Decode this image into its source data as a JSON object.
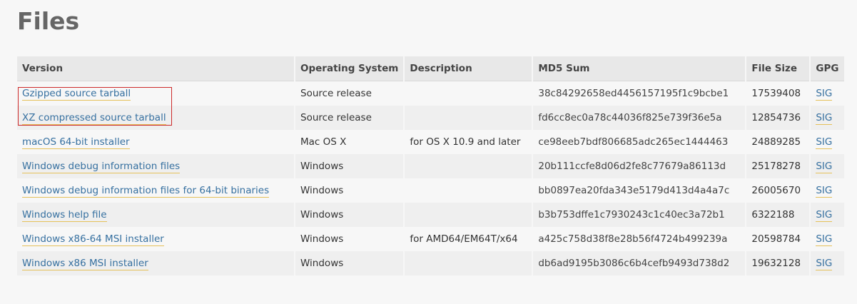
{
  "page": {
    "title": "Files"
  },
  "table": {
    "headers": {
      "version": "Version",
      "os": "Operating System",
      "description": "Description",
      "md5": "MD5 Sum",
      "size": "File Size",
      "gpg": "GPG"
    },
    "rows": [
      {
        "version": "Gzipped source tarball",
        "os": "Source release",
        "description": "",
        "md5": "38c84292658ed4456157195f1c9bcbe1",
        "size": "17539408",
        "gpg": "SIG"
      },
      {
        "version": "XZ compressed source tarball",
        "os": "Source release",
        "description": "",
        "md5": "fd6cc8ec0a78c44036f825e739f36e5a",
        "size": "12854736",
        "gpg": "SIG"
      },
      {
        "version": "macOS 64-bit installer",
        "os": "Mac OS X",
        "description": "for OS X 10.9 and later",
        "md5": "ce98eeb7bdf806685adc265ec1444463",
        "size": "24889285",
        "gpg": "SIG"
      },
      {
        "version": "Windows debug information files",
        "os": "Windows",
        "description": "",
        "md5": "20b111ccfe8d06d2fe8c77679a86113d",
        "size": "25178278",
        "gpg": "SIG"
      },
      {
        "version": "Windows debug information files for 64-bit binaries",
        "os": "Windows",
        "description": "",
        "md5": "bb0897ea20fda343e5179d413d4a4a7c",
        "size": "26005670",
        "gpg": "SIG"
      },
      {
        "version": "Windows help file",
        "os": "Windows",
        "description": "",
        "md5": "b3b753dffe1c7930243c1c40ec3a72b1",
        "size": "6322188",
        "gpg": "SIG"
      },
      {
        "version": "Windows x86-64 MSI installer",
        "os": "Windows",
        "description": "for AMD64/EM64T/x64",
        "md5": "a425c758d38f8e28b56f4724b499239a",
        "size": "20598784",
        "gpg": "SIG"
      },
      {
        "version": "Windows x86 MSI installer",
        "os": "Windows",
        "description": "",
        "md5": "db6ad9195b3086c6b4cefb9493d738d2",
        "size": "19632128",
        "gpg": "SIG"
      }
    ]
  },
  "colors": {
    "link": "#3670a0",
    "link_underline": "#e5c15a",
    "highlight_box": "#cc2a2a",
    "header_bg": "#e8e8e8",
    "page_bg": "#f7f7f7"
  }
}
